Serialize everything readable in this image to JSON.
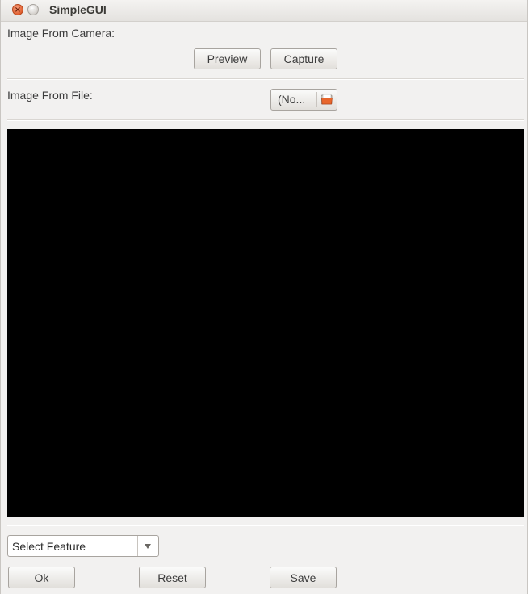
{
  "window": {
    "title": "SimpleGUI",
    "close_glyph": "×",
    "minimize_glyph": "–"
  },
  "camera": {
    "label": "Image From Camera:",
    "preview_label": "Preview",
    "capture_label": "Capture"
  },
  "file": {
    "label": "Image From File:",
    "chooser_label": "(No...",
    "chooser_icon": "folder-open-icon"
  },
  "feature": {
    "selected": "Select Feature",
    "arrow_icon": "chevron-down-icon"
  },
  "actions": {
    "ok_label": "Ok",
    "reset_label": "Reset",
    "save_label": "Save"
  },
  "colors": {
    "image_background": "#000000",
    "close_button": "#e05f2f",
    "window_background": "#f2f1f0"
  }
}
